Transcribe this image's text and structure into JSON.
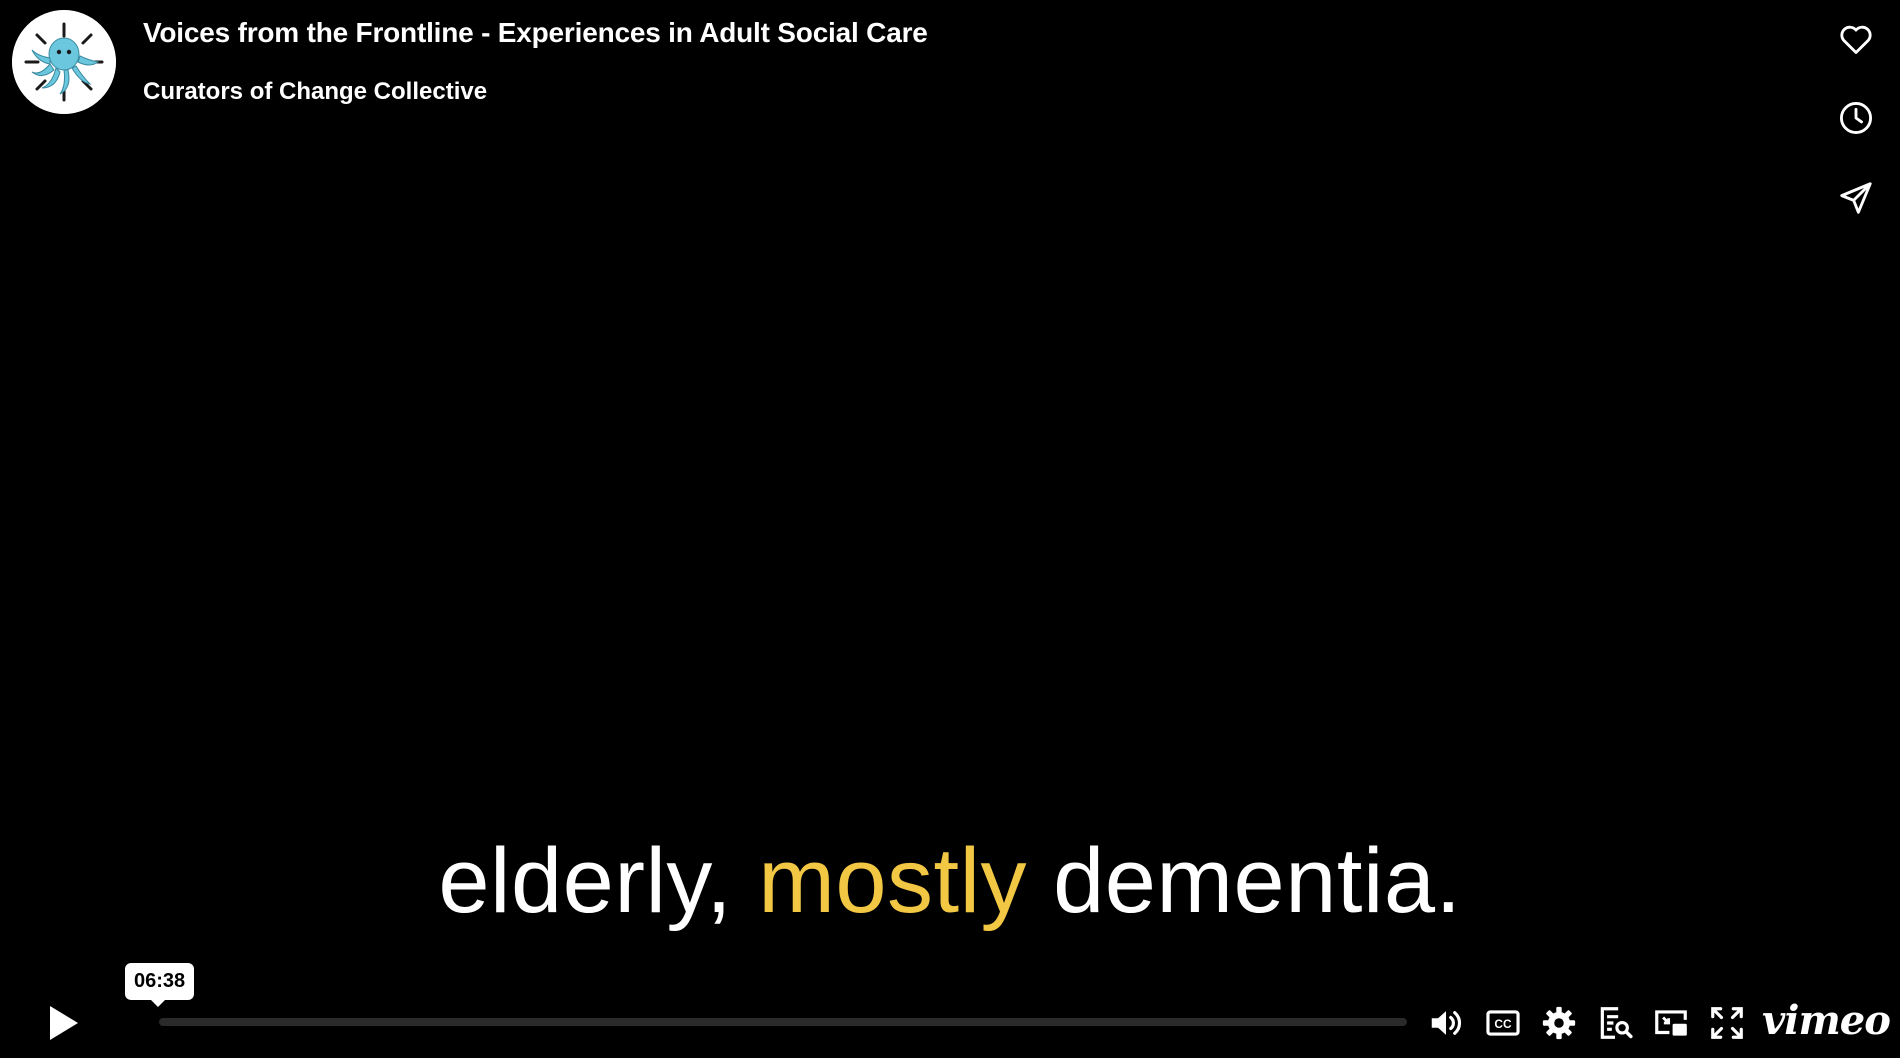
{
  "video": {
    "title": "Voices from the Frontline - Experiences in Adult Social Care",
    "byline": "Curators of Change Collective",
    "caption_before": "elderly, ",
    "caption_highlight": "mostly",
    "caption_after": " dementia."
  },
  "controls": {
    "hover_time": "06:38",
    "played_fraction": 0.0,
    "logo": "vimeo"
  },
  "icons": {
    "like": "heart-icon",
    "watch_later": "clock-icon",
    "share": "paper-plane-icon",
    "play": "play-icon",
    "volume": "volume-icon",
    "captions": "cc-icon",
    "settings": "gear-icon",
    "transcript": "transcript-search-icon",
    "pip": "picture-in-picture-icon",
    "fullscreen": "fullscreen-icon"
  },
  "colors": {
    "background": "#000000",
    "caption_text": "#ffffff",
    "caption_highlight": "#f2c744",
    "progress_track": "#2a2a2a"
  }
}
